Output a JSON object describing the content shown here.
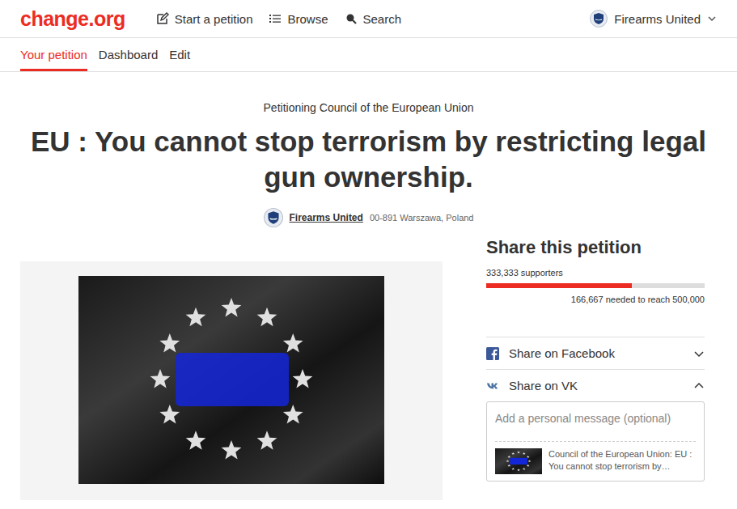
{
  "header": {
    "logo": "change.org",
    "nav": [
      {
        "label": "Start a petition"
      },
      {
        "label": "Browse"
      },
      {
        "label": "Search"
      }
    ],
    "account": {
      "name": "Firearms United",
      "expanded": false
    }
  },
  "tabs": [
    {
      "label": "Your petition",
      "selected": true
    },
    {
      "label": "Dashboard",
      "selected": false
    },
    {
      "label": "Edit",
      "selected": false
    }
  ],
  "petition": {
    "target": "Petitioning Council of the European Union",
    "title": "EU : You cannot stop terrorism by restricting legal gun ownership.",
    "author": "Firearms United",
    "location": "00-891 Warszawa, Poland"
  },
  "share": {
    "heading": "Share this petition",
    "supporters": "333,333 supporters",
    "level": 0.667,
    "needed": "166,667 needed to reach 500,000",
    "options": [
      {
        "label": "Share on Facebook",
        "expanded": false
      },
      {
        "label": "Share on VK",
        "expanded": true
      }
    ],
    "message_placeholder": "Add a personal message (optional)",
    "preview_text": "Council of the European Union: EU : You cannot stop terrorism by…"
  }
}
